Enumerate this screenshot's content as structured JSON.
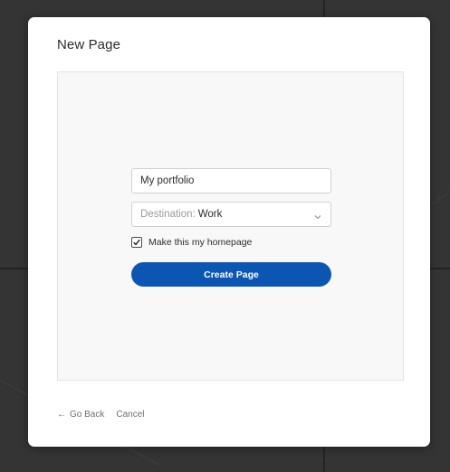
{
  "dialog": {
    "title": "New Page"
  },
  "form": {
    "page_name_value": "My portfolio",
    "destination_prefix": "Destination:",
    "destination_value": "Work",
    "homepage_checkbox_label": "Make this my homepage",
    "homepage_checked": true,
    "create_button_label": "Create Page"
  },
  "footer": {
    "go_back_arrow": "←",
    "go_back_label": "Go Back",
    "cancel_label": "Cancel"
  },
  "colors": {
    "primary_button": "#0b56b3",
    "backdrop": "#343434"
  },
  "icons": {
    "select_chevron": "chevron-down-icon",
    "checkbox_check": "checkmark-icon",
    "go_back": "arrow-left-icon"
  }
}
